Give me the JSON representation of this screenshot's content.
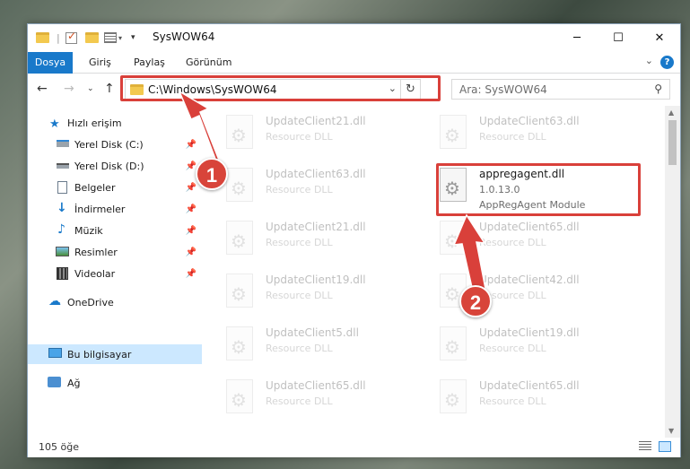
{
  "window": {
    "title": "SysWOW64"
  },
  "ribbon": {
    "tabs": [
      "Dosya",
      "Giriş",
      "Paylaş",
      "Görünüm"
    ],
    "help_label": "?"
  },
  "nav": {
    "address_path": "C:\\Windows\\SysWOW64",
    "search_placeholder": "Ara: SysWOW64"
  },
  "sidebar": {
    "items": [
      {
        "label": "Hızlı erişim",
        "icon": "star-icon",
        "pinned": false
      },
      {
        "label": "Yerel Disk (C:)",
        "icon": "drive-icon",
        "pinned": true
      },
      {
        "label": "Yerel Disk (D:)",
        "icon": "drive-icon",
        "pinned": true
      },
      {
        "label": "Belgeler",
        "icon": "document-icon",
        "pinned": true
      },
      {
        "label": "İndirmeler",
        "icon": "download-icon",
        "pinned": true
      },
      {
        "label": "Müzik",
        "icon": "music-icon",
        "pinned": true
      },
      {
        "label": "Resimler",
        "icon": "pictures-icon",
        "pinned": true
      },
      {
        "label": "Videolar",
        "icon": "video-icon",
        "pinned": true
      },
      {
        "label": "OneDrive",
        "icon": "cloud-icon",
        "pinned": false
      },
      {
        "label": "Bu bilgisayar",
        "icon": "computer-icon",
        "pinned": false,
        "selected": true
      },
      {
        "label": "Ağ",
        "icon": "network-icon",
        "pinned": false
      }
    ]
  },
  "files": {
    "left_column": [
      {
        "name": "UpdateClient21.dll",
        "desc": "Resource DLL"
      },
      {
        "name": "UpdateClient63.dll",
        "desc": "Resource DLL"
      },
      {
        "name": "UpdateClient21.dll",
        "desc": "Resource DLL"
      },
      {
        "name": "UpdateClient19.dll",
        "desc": "Resource DLL"
      },
      {
        "name": "UpdateClient5.dll",
        "desc": "Resource DLL"
      },
      {
        "name": "UpdateClient65.dll",
        "desc": "Resource DLL"
      }
    ],
    "right_column": [
      {
        "name": "UpdateClient63.dll",
        "desc": "Resource DLL"
      },
      {
        "name": "appregagent.dll",
        "version": "1.0.13.0",
        "desc": "AppRegAgent Module",
        "highlighted": true
      },
      {
        "name": "UpdateClient65.dll",
        "desc": "Resource DLL"
      },
      {
        "name": "UpdateClient42.dll",
        "desc": "Resource DLL"
      },
      {
        "name": "UpdateClient19.dll",
        "desc": "Resource DLL"
      },
      {
        "name": "UpdateClient65.dll",
        "desc": "Resource DLL"
      }
    ]
  },
  "status": {
    "item_count": "105 öğe"
  },
  "annotations": {
    "step1": "1",
    "step2": "2",
    "color": "#d9403a"
  }
}
